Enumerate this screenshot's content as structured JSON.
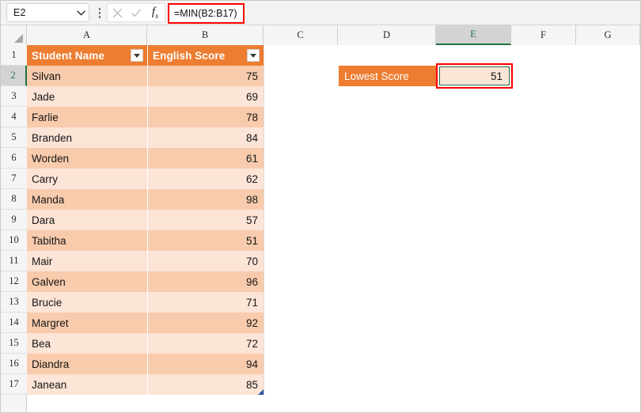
{
  "window": {
    "active_cell": "E2",
    "formula": "=MIN(B2:B17)"
  },
  "name_box": {
    "value": "E2",
    "chevron_icon": "chevron-down-icon",
    "kebab_icon": "more-options-icon"
  },
  "formula_bar": {
    "cancel_icon": "cancel-icon",
    "enter_icon": "enter-checkmark-icon",
    "function_icon": "insert-function-fx-icon",
    "formula_text": "=MIN(B2:B17)"
  },
  "grid": {
    "columns": [
      "A",
      "B",
      "C",
      "D",
      "E",
      "F",
      "G"
    ],
    "active_column": "E",
    "rows": [
      "1",
      "2",
      "3",
      "4",
      "5",
      "6",
      "7",
      "8",
      "9",
      "10",
      "11",
      "12",
      "13",
      "14",
      "15",
      "16",
      "17"
    ],
    "active_row": "2",
    "select_all_icon": "select-all-corner-icon"
  },
  "table": {
    "headers": [
      "Student Name",
      "English Score"
    ],
    "filter_icon": "filter-dropdown-icon",
    "resize_icon": "table-resize-handle-icon",
    "rows": [
      {
        "row": "2",
        "name": "Silvan",
        "score": "75"
      },
      {
        "row": "3",
        "name": "Jade",
        "score": "69"
      },
      {
        "row": "4",
        "name": "Farlie",
        "score": "78"
      },
      {
        "row": "5",
        "name": "Branden",
        "score": "84"
      },
      {
        "row": "6",
        "name": "Worden",
        "score": "61"
      },
      {
        "row": "7",
        "name": "Carry",
        "score": "62"
      },
      {
        "row": "8",
        "name": "Manda",
        "score": "98"
      },
      {
        "row": "9",
        "name": "Dara",
        "score": "57"
      },
      {
        "row": "10",
        "name": "Tabitha",
        "score": "51"
      },
      {
        "row": "11",
        "name": "Mair",
        "score": "70"
      },
      {
        "row": "12",
        "name": "Galven",
        "score": "96"
      },
      {
        "row": "13",
        "name": "Brucie",
        "score": "71"
      },
      {
        "row": "14",
        "name": "Margret",
        "score": "92"
      },
      {
        "row": "15",
        "name": "Bea",
        "score": "72"
      },
      {
        "row": "16",
        "name": "Diandra",
        "score": "94"
      },
      {
        "row": "17",
        "name": "Janean",
        "score": "85"
      }
    ]
  },
  "result": {
    "label": "Lowest Score",
    "value": "51"
  },
  "colors": {
    "header_orange": "#ED7D31",
    "band_dark": "#F8CBAD",
    "band_light": "#FCE4D6",
    "annotation_red": "#FF0000",
    "excel_green": "#217346"
  }
}
